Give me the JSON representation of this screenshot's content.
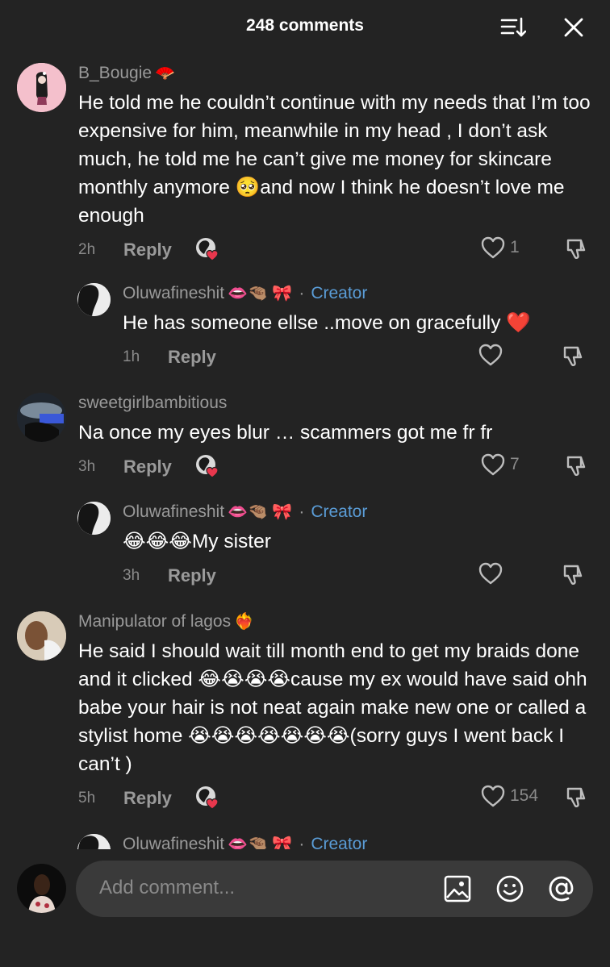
{
  "header": {
    "title": "248 comments",
    "sort_icon": "sort-icon",
    "close_icon": "close-icon"
  },
  "comments": [
    {
      "username": "B_Bougie",
      "username_emoji": "🪭",
      "text": "He told me he couldn’t continue with my needs that I’m too expensive for him, meanwhile in my head , I don’t ask much, he told me he can’t give me money for skincare monthly anymore 🥺and now I think he doesn’t love me enough",
      "time": "2h",
      "reply": "Reply",
      "likes": "1"
    },
    {
      "username": "Oluwafineshit",
      "username_emoji": "👄🤏🏽 🎀",
      "creator_sep": "·",
      "creator": "Creator",
      "text": "He has someone ellse ..move on gracefully ❤️",
      "time": "1h",
      "reply": "Reply"
    },
    {
      "username": "sweetgirlbambitious",
      "text": "Na once my eyes blur … scammers got me fr fr",
      "time": "3h",
      "reply": "Reply",
      "likes": "7"
    },
    {
      "username": "Oluwafineshit",
      "username_emoji": "👄🤏🏽 🎀",
      "creator_sep": "·",
      "creator": "Creator",
      "text": "😂😂😂My sister",
      "time": "3h",
      "reply": "Reply"
    },
    {
      "username": "Manipulator of lagos",
      "username_emoji": "❤️‍🔥",
      "text": "He said I should wait till month end to get my braids done and it clicked 😂😭😭😭cause my ex would have said ohh babe your hair is not neat again make new one or called a stylist home 😭😭😭😭😭😭😭(sorry guys I went back I can’t )",
      "time": "5h",
      "reply": "Reply",
      "likes": "154"
    },
    {
      "username": "Oluwafineshit",
      "username_emoji": "👄🤏🏽 🎀",
      "creator_sep": "·",
      "creator": "Creator"
    }
  ],
  "composer": {
    "placeholder": "Add comment...",
    "icons": [
      "image-icon",
      "emoji-icon",
      "mention-icon"
    ]
  },
  "colors": {
    "background": "#232323",
    "creator": "#5a9cd6",
    "muted": "#9a9a9a",
    "input_bg": "#3a3a3a",
    "heart_red": "#e8374d"
  }
}
